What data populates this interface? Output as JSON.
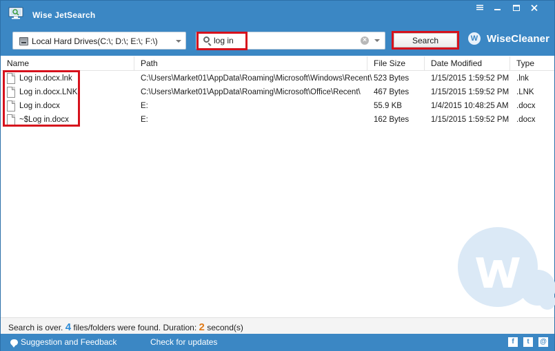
{
  "window": {
    "title": "Wise JetSearch",
    "controls": [
      "minimize-icon",
      "maximize-icon",
      "close-icon"
    ]
  },
  "toolbar": {
    "drive_select": "Local Hard Drives(C:\\; D:\\; E:\\; F:\\)",
    "search_value": "log in",
    "search_button": "Search",
    "brand": "WiseCleaner"
  },
  "table": {
    "columns": [
      "Name",
      "Path",
      "File Size",
      "Date Modified",
      "Type"
    ],
    "rows": [
      {
        "name": "Log in.docx.lnk",
        "path": "C:\\Users\\Market01\\AppData\\Roaming\\Microsoft\\Windows\\Recent\\",
        "size": "523 Bytes",
        "date": "1/15/2015 1:59:52 PM",
        "type": ".lnk"
      },
      {
        "name": "Log in.docx.LNK",
        "path": "C:\\Users\\Market01\\AppData\\Roaming\\Microsoft\\Office\\Recent\\",
        "size": "467 Bytes",
        "date": "1/15/2015 1:59:52 PM",
        "type": ".LNK"
      },
      {
        "name": "Log in.docx",
        "path": "E:",
        "size": "55.9 KB",
        "date": "1/4/2015 10:48:25 AM",
        "type": ".docx"
      },
      {
        "name": "~$Log in.docx",
        "path": "E:",
        "size": "162 Bytes",
        "date": "1/15/2015 1:59:52 PM",
        "type": ".docx"
      }
    ]
  },
  "status": {
    "prefix": "Search is over.",
    "count": "4",
    "middle": "files/folders were found. Duration:",
    "duration": "2",
    "suffix": "second(s)"
  },
  "footer": {
    "feedback": "Suggestion and Feedback",
    "updates": "Check for updates",
    "social": [
      {
        "name": "facebook-icon",
        "glyph": "f"
      },
      {
        "name": "twitter-icon",
        "glyph": "t"
      },
      {
        "name": "email-icon",
        "glyph": "@"
      }
    ]
  },
  "colors": {
    "accent": "#3b87c4",
    "highlight": "#d6111c",
    "count": "#2b8ad6",
    "duration": "#e07a17"
  }
}
